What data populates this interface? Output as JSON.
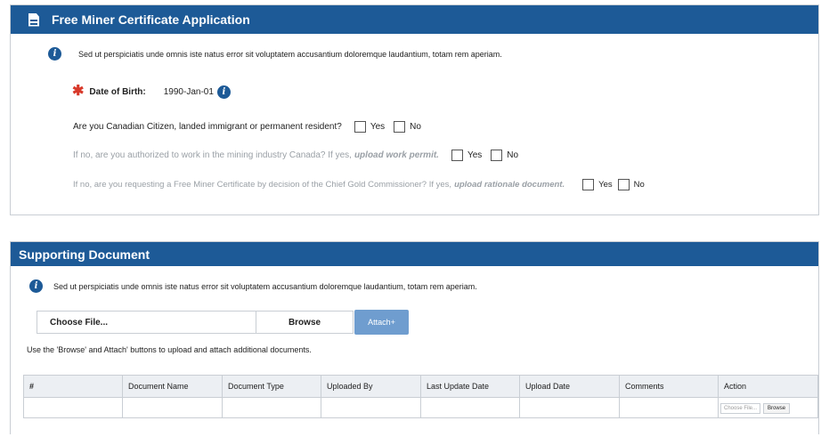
{
  "section1": {
    "title": "Free Miner Certificate Application",
    "info_text": "Sed ut perspiciatis unde omnis iste natus error sit voluptatem accusantium doloremque laudantium, totam rem aperiam.",
    "dob_label": "Date of Birth:",
    "dob_value": "1990-Jan-01",
    "q1": {
      "text": "Are you Canadian Citizen, landed immigrant or permanent resident?",
      "yes": "Yes",
      "no": "No"
    },
    "q2": {
      "text": "If no, are you authorized to work in the mining industry Canada?  If yes,",
      "emph": "upload work permit.",
      "yes": "Yes",
      "no": "No"
    },
    "q3": {
      "text": "If no, are you requesting a Free Miner Certificate by decision of the Chief Gold Commissioner?  If yes,",
      "emph": "upload rationale document.",
      "yes": "Yes",
      "no": "No"
    }
  },
  "section2": {
    "title": "Supporting Document",
    "info_text": "Sed ut perspiciatis unde omnis iste natus error sit voluptatem accusantium doloremque laudantium, totam rem aperiam.",
    "choose_file_label": "Choose File...",
    "browse_label": "Browse",
    "attach_label": "Attach+",
    "help_text": "Use the 'Browse' and Attach' buttons to upload and attach additional documents.",
    "table": {
      "headers": [
        "#",
        "Document Name",
        "Document Type",
        "Uploaded By",
        "Last Update Date",
        "Upload Date",
        "Comments",
        "Action"
      ],
      "row_action_input": "Choose File...",
      "row_action_button": "Browse"
    }
  },
  "colors": {
    "header": "#1d5a97",
    "required": "#d83a2b",
    "attach_button": "#6f9dcf"
  }
}
